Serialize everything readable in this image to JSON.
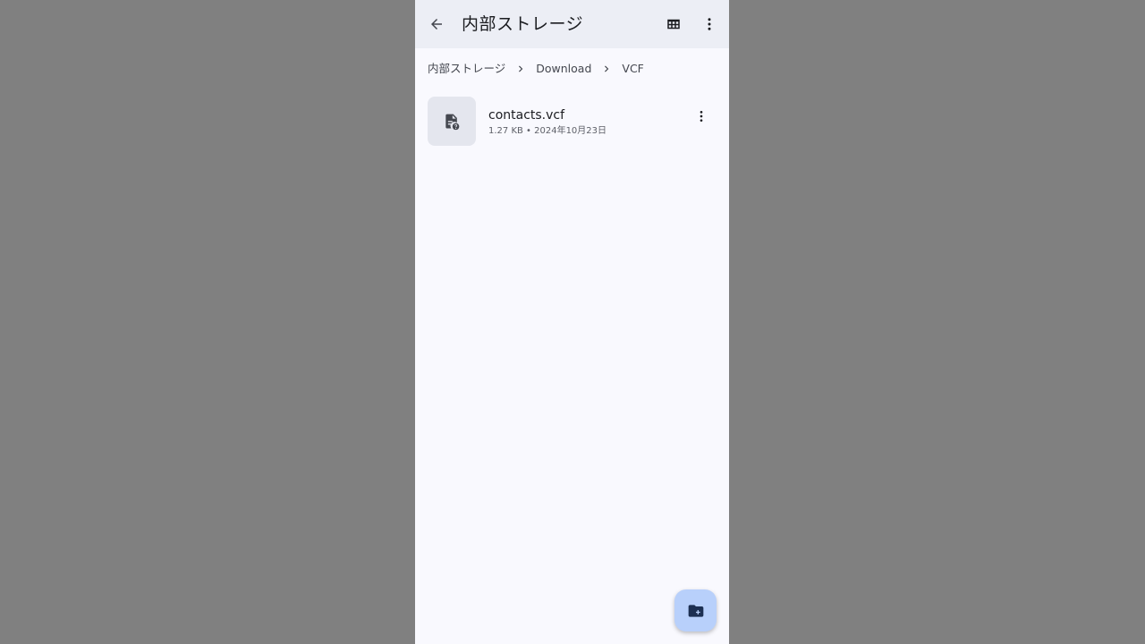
{
  "appbar": {
    "title": "内部ストレージ",
    "back_icon": "arrow-back-icon",
    "grid_icon": "grid-view-icon",
    "more_icon": "more-vert-icon"
  },
  "breadcrumb": {
    "items": [
      "内部ストレージ",
      "Download",
      "VCF"
    ],
    "separator_icon": "chevron-right-icon"
  },
  "files": [
    {
      "name": "contacts.vcf",
      "meta": "1.27 KB • 2024年10月23日",
      "icon": "unknown-file-icon"
    }
  ],
  "fab": {
    "icon": "new-folder-icon"
  },
  "colors": {
    "background": "#f9f9fe",
    "appbar": "#eceef5",
    "fab": "#b8d0fb",
    "icon": "#44474f",
    "fab_icon": "#1c2f52"
  }
}
